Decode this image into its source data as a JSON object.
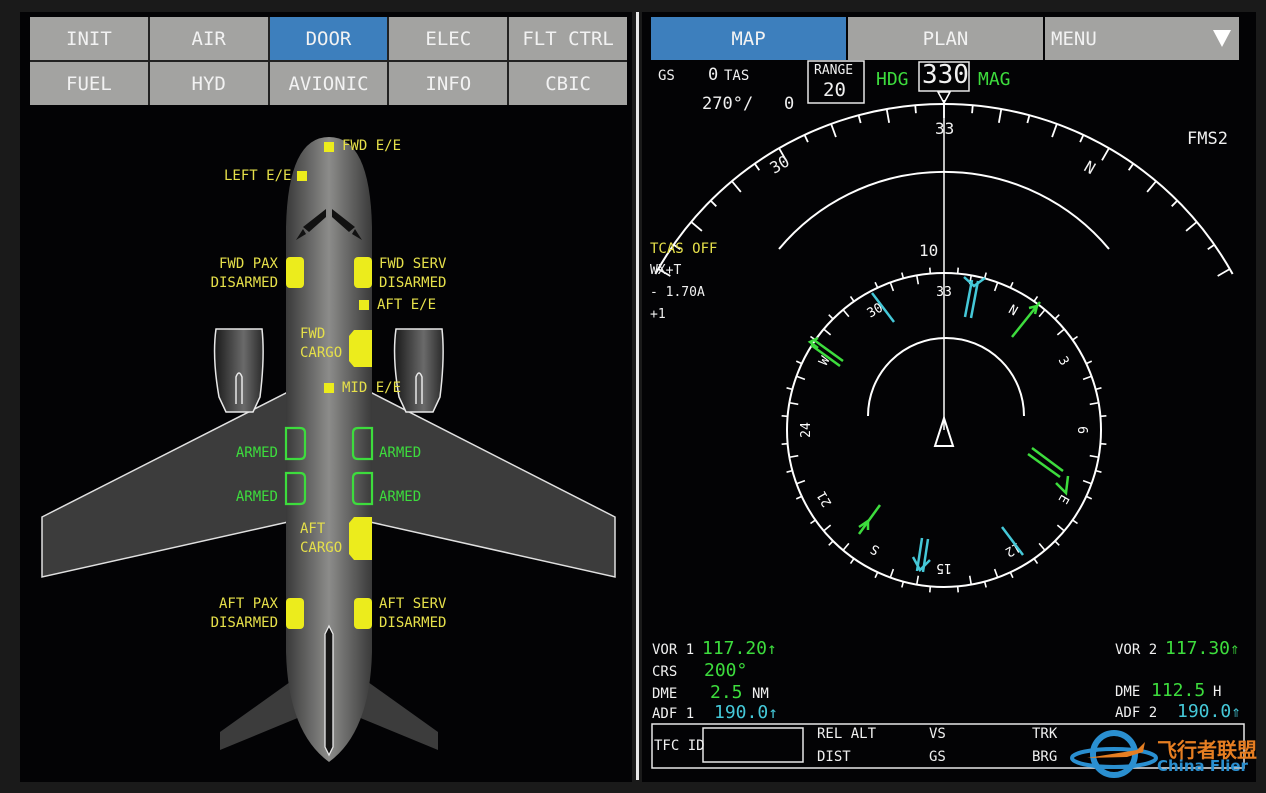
{
  "synoptic": {
    "tabs": [
      {
        "label": "INIT",
        "active": false
      },
      {
        "label": "AIR",
        "active": false
      },
      {
        "label": "DOOR",
        "active": true
      },
      {
        "label": "ELEC",
        "active": false
      },
      {
        "label": "FLT CTRL",
        "active": false
      },
      {
        "label": "FUEL",
        "active": false
      },
      {
        "label": "HYD",
        "active": false
      },
      {
        "label": "AVIONIC",
        "active": false
      },
      {
        "label": "INFO",
        "active": false
      },
      {
        "label": "CBIC",
        "active": false
      }
    ],
    "doors": {
      "fwd_ee": "FWD E/E",
      "left_ee": "LEFT E/E",
      "fwd_pax": {
        "name": "FWD PAX",
        "status": "DISARMED"
      },
      "fwd_serv": {
        "name": "FWD SERV",
        "status": "DISARMED"
      },
      "aft_ee": "AFT E/E",
      "fwd_cargo": {
        "line1": "FWD",
        "line2": "CARGO"
      },
      "mid_ee": "MID E/E",
      "overwing_left_1": "ARMED",
      "overwing_right_1": "ARMED",
      "overwing_left_2": "ARMED",
      "overwing_right_2": "ARMED",
      "aft_cargo": {
        "line1": "AFT",
        "line2": "CARGO"
      },
      "aft_pax": {
        "name": "AFT PAX",
        "status": "DISARMED"
      },
      "aft_serv": {
        "name": "AFT SERV",
        "status": "DISARMED"
      }
    },
    "colors": {
      "closed": "#ecec1c",
      "armed": "#3ddc3d",
      "active_tab": "#3d7fbd"
    }
  },
  "nav": {
    "tabs": {
      "map": "MAP",
      "plan": "PLAN",
      "menu": "MENU"
    },
    "gs_label": "GS",
    "gs_value": "0",
    "tas_label": "TAS",
    "wind": "270°/",
    "wind_speed": "0",
    "range_label": "RANGE",
    "range_value": "20",
    "hdg_label": "HDG",
    "hdg_value": "330",
    "mag_label": "MAG",
    "source": "FMS2",
    "tcas": "TCAS OFF",
    "wx": "WX+T",
    "tilt": "- 1.70A",
    "gain": "+1",
    "outer_labels": {
      "left": "30",
      "center": "33",
      "right": "N"
    },
    "range_ring": "10",
    "compass_labels": [
      "33",
      "N",
      "3",
      "6",
      "E",
      "12",
      "15",
      "S",
      "21",
      "24",
      "W",
      "30"
    ],
    "vor1": {
      "label": "VOR 1",
      "freq": "117.20"
    },
    "crs": {
      "label": "CRS",
      "value": "200°"
    },
    "dme1": {
      "label": "DME",
      "value": "2.5",
      "unit": "NM"
    },
    "adf1": {
      "label": "ADF 1",
      "freq": "190.0"
    },
    "vor2": {
      "label": "VOR 2",
      "freq": "117.30"
    },
    "dme2": {
      "label": "DME",
      "value": "112.5",
      "unit": "H"
    },
    "adf2": {
      "label": "ADF 2",
      "freq": "190.0"
    },
    "tfc": {
      "id_label": "TFC ID",
      "id_value": "",
      "rel_alt": "REL ALT",
      "dist": "DIST",
      "vs": "VS",
      "gs": "GS",
      "trk": "TRK",
      "brg": "BRG"
    },
    "colors": {
      "green": "#3ddc3d",
      "cyan": "#45c8d8",
      "yellow": "#e6e04a"
    }
  },
  "watermark": {
    "cn": "飞行者联盟",
    "en": "China Flier"
  }
}
